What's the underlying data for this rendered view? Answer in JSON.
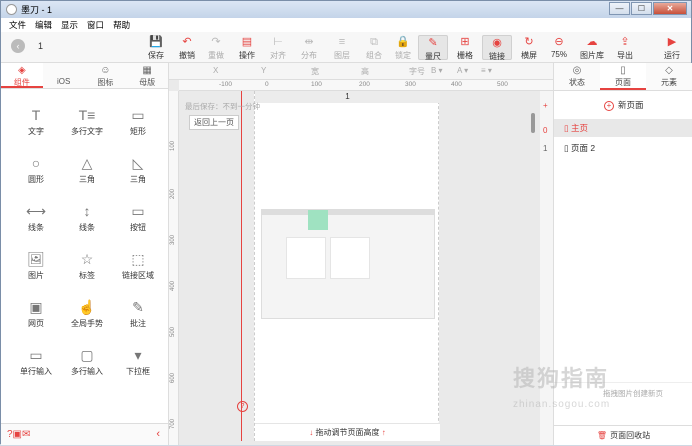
{
  "window": {
    "title": "墨刀 - 1",
    "minimize": "—",
    "maximize": "☐",
    "close": "✕"
  },
  "menu": [
    "文件",
    "编辑",
    "显示",
    "窗口",
    "帮助"
  ],
  "toolbar": {
    "back_icon": "arrow-left-icon",
    "page_number": "1",
    "tools": [
      {
        "label": "保存",
        "icon": "save-icon",
        "glyph": "💾",
        "disabled": false
      },
      {
        "label": "撤销",
        "icon": "undo-icon",
        "glyph": "↶",
        "disabled": false
      },
      {
        "label": "重做",
        "icon": "redo-icon",
        "glyph": "↷",
        "disabled": true
      },
      {
        "label": "操作",
        "icon": "action-icon",
        "glyph": "▤",
        "disabled": false
      },
      {
        "label": "对齐",
        "icon": "align-icon",
        "glyph": "⊢",
        "disabled": true
      },
      {
        "label": "分布",
        "icon": "distribute-icon",
        "glyph": "⇹",
        "disabled": true
      },
      {
        "label": "图层",
        "icon": "layer-icon",
        "glyph": "≡",
        "disabled": true
      },
      {
        "label": "组合",
        "icon": "group-icon",
        "glyph": "⧉",
        "disabled": true
      },
      {
        "label": "锁定",
        "icon": "lock-icon",
        "glyph": "🔒",
        "disabled": true
      },
      {
        "label": "量尺",
        "icon": "ruler-icon",
        "glyph": "✎",
        "disabled": false,
        "active": true
      },
      {
        "label": "栅格",
        "icon": "grid-icon",
        "glyph": "⊞",
        "disabled": false
      },
      {
        "label": "链接",
        "icon": "link-eye-icon",
        "glyph": "◉",
        "disabled": false,
        "active": true
      },
      {
        "label": "横屏",
        "icon": "rotate-icon",
        "glyph": "↻",
        "disabled": false
      },
      {
        "label": "75%",
        "icon": "zoom-icon",
        "glyph": "⊖",
        "disabled": false
      },
      {
        "label": "图片库",
        "icon": "image-library-icon",
        "glyph": "☁",
        "disabled": false
      },
      {
        "label": "导出",
        "icon": "export-icon",
        "glyph": "⇪",
        "disabled": false
      },
      {
        "label": "运行",
        "icon": "run-icon",
        "glyph": "▶",
        "disabled": false
      }
    ]
  },
  "left_tabs": [
    {
      "label": "组件",
      "icon": "cube-icon",
      "glyph": "◈",
      "active": true
    },
    {
      "label": "iOS",
      "icon": "apple-icon",
      "glyph": "",
      "active": false
    },
    {
      "label": "图标",
      "icon": "smiley-icon",
      "glyph": "☺",
      "active": false
    },
    {
      "label": "母版",
      "icon": "master-icon",
      "glyph": "▦",
      "active": false
    }
  ],
  "components": [
    {
      "label": "文字",
      "icon": "text-icon",
      "glyph": "T"
    },
    {
      "label": "多行文字",
      "icon": "multiline-text-icon",
      "glyph": "T≡"
    },
    {
      "label": "矩形",
      "icon": "rectangle-icon",
      "glyph": "▭"
    },
    {
      "label": "圆形",
      "icon": "circle-icon",
      "glyph": "○"
    },
    {
      "label": "三角",
      "icon": "triangle-icon",
      "glyph": "△"
    },
    {
      "label": "三角",
      "icon": "right-triangle-icon",
      "glyph": "◺"
    },
    {
      "label": "线条",
      "icon": "horizontal-line-icon",
      "glyph": "⟷"
    },
    {
      "label": "线条",
      "icon": "vertical-line-icon",
      "glyph": "↕"
    },
    {
      "label": "按钮",
      "icon": "button-icon",
      "glyph": "▭"
    },
    {
      "label": "图片",
      "icon": "image-icon",
      "glyph": "🖼"
    },
    {
      "label": "标签",
      "icon": "tag-star-icon",
      "glyph": "☆"
    },
    {
      "label": "链接区域",
      "icon": "link-area-icon",
      "glyph": "⬚"
    },
    {
      "label": "网页",
      "icon": "webpage-icon",
      "glyph": "▣"
    },
    {
      "label": "全局手势",
      "icon": "gesture-icon",
      "glyph": "☝"
    },
    {
      "label": "批注",
      "icon": "annotation-icon",
      "glyph": "✎"
    },
    {
      "label": "单行输入",
      "icon": "single-input-icon",
      "glyph": "▭"
    },
    {
      "label": "多行输入",
      "icon": "multi-input-icon",
      "glyph": "▢"
    },
    {
      "label": "下拉框",
      "icon": "dropdown-icon",
      "glyph": "▾"
    }
  ],
  "left_footer": {
    "help_icon": "question-icon",
    "collapse_icon": "chevron-left-icon"
  },
  "props_bar": {
    "x": "X",
    "y": "Y",
    "w": "宽",
    "h": "高",
    "font": "字号"
  },
  "ruler_top": [
    "-100",
    "0",
    "100",
    "200",
    "300",
    "400",
    "500"
  ],
  "ruler_left": [
    "100",
    "200",
    "300",
    "400",
    "500",
    "600",
    "700"
  ],
  "canvas": {
    "page_header": "1",
    "info_text": "最后保存：不到一分钟",
    "back_button": "返回上一页",
    "footer_text": "拖动调节页面高度",
    "help_icon": "question-icon"
  },
  "right_tabs": [
    {
      "label": "状态",
      "icon": "state-icon",
      "glyph": "◎",
      "active": false
    },
    {
      "label": "页面",
      "icon": "page-icon",
      "glyph": "▯",
      "active": true
    },
    {
      "label": "元素",
      "icon": "element-icon",
      "glyph": "◇",
      "active": false
    }
  ],
  "pages": {
    "new_page_label": "新页面",
    "add_icon": "plus-icon",
    "list": [
      {
        "index": "0",
        "name": "主页",
        "selected": true
      },
      {
        "index": "1",
        "name": "页面 2",
        "selected": false
      }
    ],
    "image_drop_hint": "拖拽图片创建新页",
    "recycle_label": "页面回收站"
  },
  "watermark": {
    "line1": "搜狗指南",
    "line2": "zhinan.sogou.com"
  },
  "colors": {
    "accent": "#e64340",
    "highlight": "#9fe2c1"
  }
}
